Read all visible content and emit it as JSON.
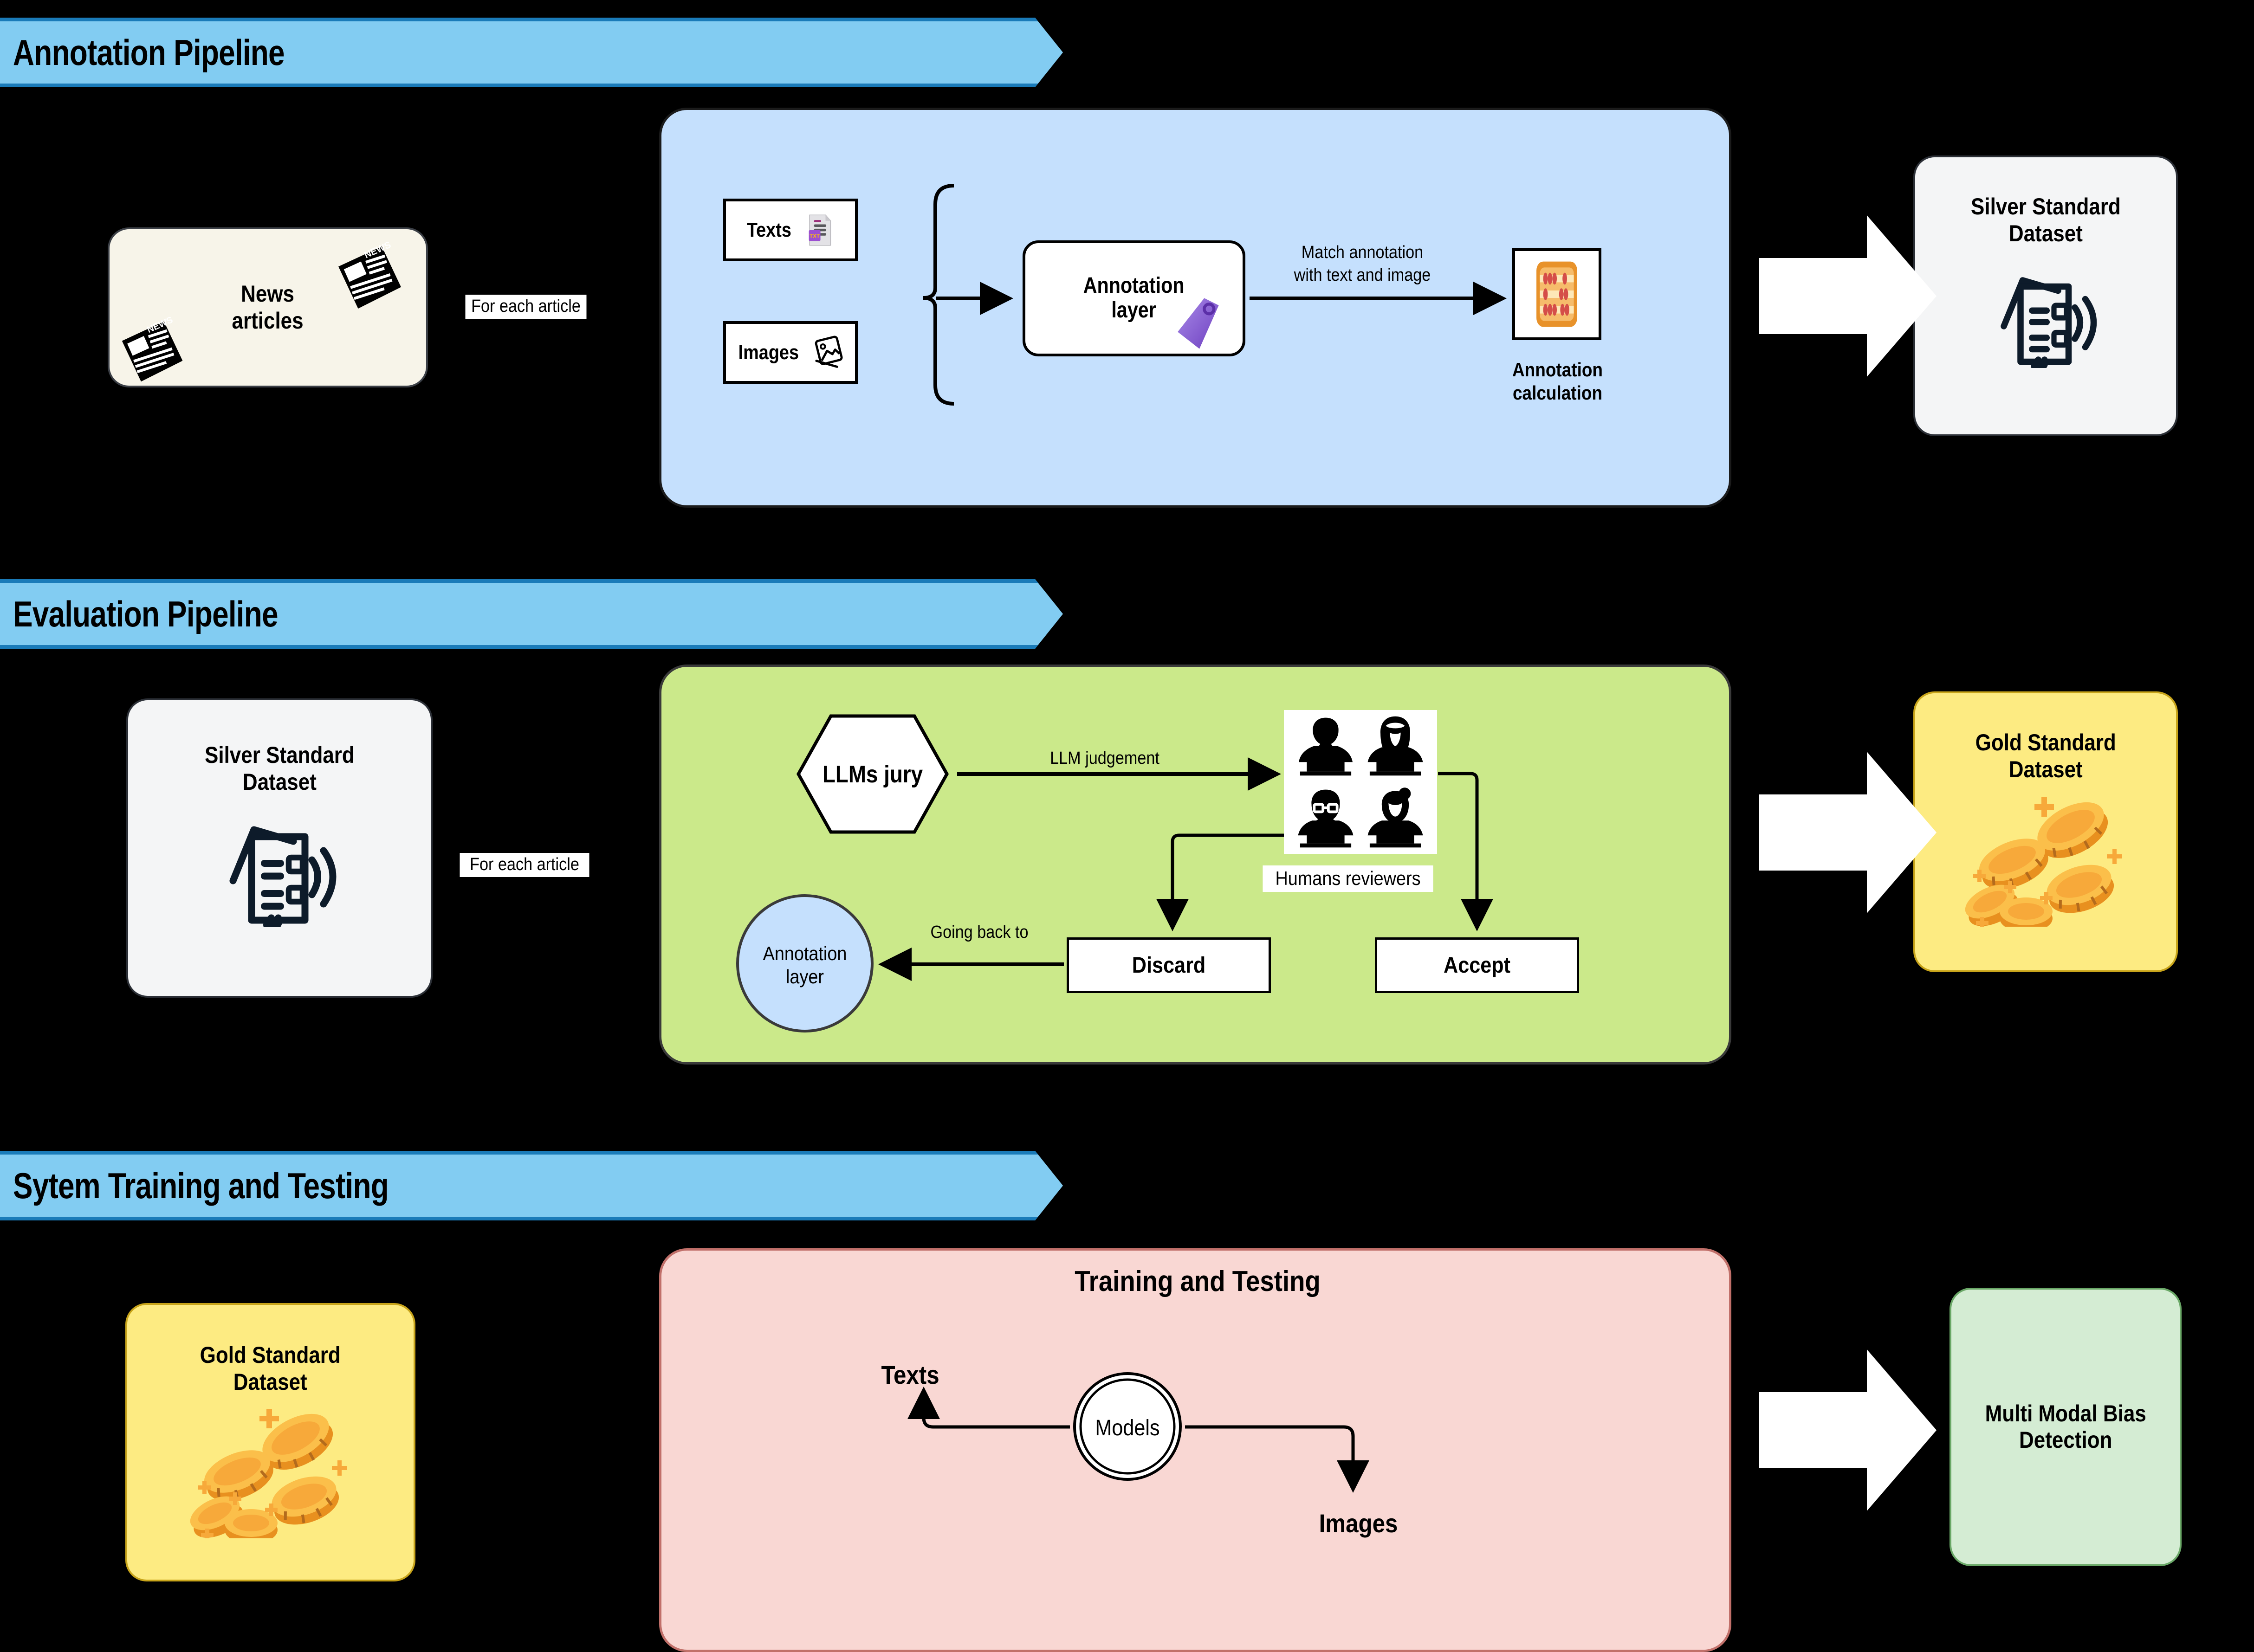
{
  "sections": [
    {
      "id": "annotation",
      "banner": "Annotation Pipeline"
    },
    {
      "id": "evaluation",
      "banner": "Evaluation Pipeline"
    },
    {
      "id": "training",
      "banner": "Sytem Training and Testing"
    }
  ],
  "annotation_pipeline": {
    "source_box": {
      "label": "News\narticles",
      "icon": "newspaper-icon"
    },
    "edge_label": "For each article",
    "inputs": [
      {
        "label": "Texts",
        "icon": "text-file-icon"
      },
      {
        "label": "Images",
        "icon": "picture-icon"
      }
    ],
    "process": {
      "label": "Annotation\nlayer",
      "icon": "tag-icon"
    },
    "match_label": "Match annotation\nwith text and image",
    "calculation": {
      "caption": "Annotation\ncalculation",
      "icon": "abacus-icon"
    },
    "output_box": {
      "label": "Silver Standard\nDataset",
      "icon": "document-signal-icon"
    }
  },
  "evaluation_pipeline": {
    "source_box": {
      "label": "Silver Standard\nDataset",
      "icon": "document-signal-icon"
    },
    "edge_label": "For each article",
    "jury": {
      "label": "LLMs jury"
    },
    "judgement_label": "LLM judgement",
    "reviewers": {
      "caption": "Humans reviewers",
      "icon": "people-at-laptops-icon"
    },
    "discard": {
      "label": "Discard"
    },
    "accept": {
      "label": "Accept"
    },
    "back_label": "Going back to",
    "annotation_layer": {
      "label": "Annotation\nlayer"
    },
    "output_box": {
      "label": "Gold Standard\nDataset",
      "icon": "gold-coins-icon"
    }
  },
  "training_pipeline": {
    "source_box": {
      "label": "Gold Standard\nDataset",
      "icon": "gold-coins-icon"
    },
    "panel_title": "Training and Testing",
    "models": {
      "label": "Models"
    },
    "texts_label": "Texts",
    "images_label": "Images",
    "output_box": {
      "label": "Multi Modal Bias\nDetection"
    }
  },
  "colors": {
    "banner_fill": "#82ccf2",
    "banner_border": "#1a7bb9",
    "panel_blue": "#c5e0fd",
    "panel_green": "#cbe98a",
    "panel_pink": "#f9d7d3",
    "box_cream": "#f7f4e9",
    "box_grey": "#f4f5f6",
    "box_gold": "#fdeb82",
    "box_mint": "#d4ecd3",
    "tag_purple": "#8b5cd6",
    "coin_gold": "#f5a623",
    "abacus_orange": "#e8922a",
    "arrow_white": "#ffffff"
  }
}
